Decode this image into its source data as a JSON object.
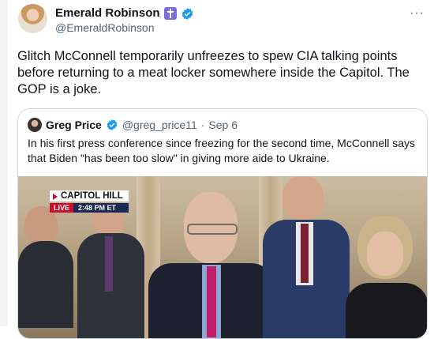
{
  "author": {
    "name": "Emerald Robinson",
    "handle": "@EmeraldRobinson",
    "badge_icon": "cross-icon",
    "verified_color": "#1d9bf0"
  },
  "more_label": "···",
  "tweet": {
    "text": "Glitch McConnell temporarily unfreezes to spew CIA talking points before returning to a meat locker somewhere inside the Capitol. The GOP is a joke."
  },
  "quoted": {
    "name": "Greg Price",
    "handle": "@greg_price11",
    "separator": "·",
    "date": "Sep 6",
    "text": "In his first press conference since freezing for the second time, McConnell says that Biden \"has been too slow\" in giving more aide to Ukraine."
  },
  "media": {
    "chyron_location": "CAPITOL HILL",
    "chyron_live": "LIVE",
    "chyron_time": "2:48 PM ET"
  }
}
